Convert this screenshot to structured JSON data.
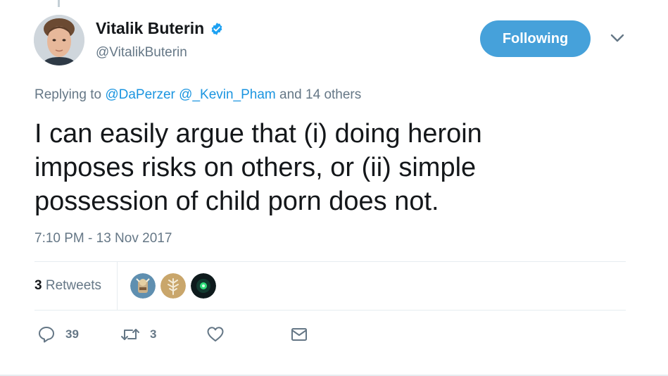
{
  "author": {
    "display_name": "Vitalik Buterin",
    "handle": "@VitalikButerin",
    "verified": true
  },
  "follow_button": {
    "label": "Following"
  },
  "reply": {
    "prefix": "Replying to",
    "mention_1": "@DaPerzer",
    "mention_2": "@_Kevin_Pham",
    "suffix": "and 14 others"
  },
  "tweet": {
    "text": "I can easily argue that (i) doing heroin\nimposes risks on others, or (ii) simple\npossession of child porn does not.",
    "timestamp": "7:10 PM - 13 Nov 2017"
  },
  "stats": {
    "retweets_count": "3",
    "retweets_label": "Retweets"
  },
  "actions": {
    "reply_count": "39",
    "retweet_count": "3"
  },
  "colors": {
    "accent": "#1b95e0",
    "follow_bg": "#46a1da",
    "muted": "#657786"
  },
  "icons": [
    "verified-badge-icon",
    "chevron-down-icon",
    "reply-icon",
    "retweet-icon",
    "like-icon",
    "message-icon"
  ]
}
